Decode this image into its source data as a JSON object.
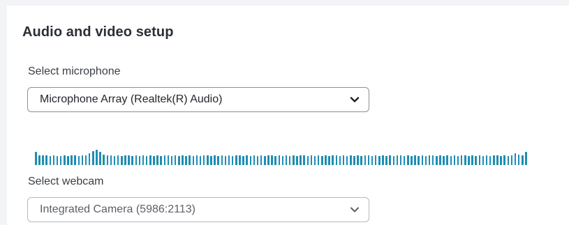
{
  "section": {
    "title": "Audio and video setup"
  },
  "microphone": {
    "label": "Select microphone",
    "selected": "Microphone Array (Realtek(R) Audio)"
  },
  "audio_level_meter": {
    "levels": [
      0.8,
      0.6,
      0.58,
      0.58,
      0.56,
      0.58,
      0.56,
      0.56,
      0.58,
      0.56,
      0.58,
      0.58,
      0.56,
      0.58,
      0.6,
      0.72,
      0.85,
      0.9,
      0.8,
      0.62,
      0.6,
      0.58,
      0.56,
      0.58,
      0.56,
      0.58,
      0.58,
      0.56,
      0.58,
      0.56,
      0.58,
      0.56,
      0.58,
      0.56,
      0.58,
      0.56,
      0.58,
      0.58,
      0.56,
      0.58,
      0.56,
      0.58,
      0.56,
      0.58,
      0.56,
      0.58,
      0.56,
      0.58,
      0.58,
      0.56,
      0.58,
      0.56,
      0.58,
      0.56,
      0.58,
      0.56,
      0.58,
      0.58,
      0.56,
      0.58,
      0.56,
      0.58,
      0.56,
      0.58,
      0.56,
      0.58,
      0.58,
      0.56,
      0.58,
      0.56,
      0.58,
      0.56,
      0.58,
      0.56,
      0.58,
      0.58,
      0.56,
      0.58,
      0.56,
      0.58,
      0.56,
      0.58,
      0.56,
      0.58,
      0.58,
      0.56,
      0.58,
      0.56,
      0.58,
      0.56,
      0.58,
      0.56,
      0.58,
      0.58,
      0.56,
      0.58,
      0.56,
      0.58,
      0.56,
      0.58,
      0.56,
      0.58,
      0.58,
      0.56,
      0.58,
      0.56,
      0.58,
      0.56,
      0.58,
      0.56,
      0.58,
      0.58,
      0.56,
      0.58,
      0.56,
      0.58,
      0.56,
      0.58,
      0.56,
      0.58,
      0.58,
      0.56,
      0.58,
      0.56,
      0.58,
      0.56,
      0.58,
      0.56,
      0.58,
      0.58,
      0.56,
      0.58,
      0.56,
      0.6,
      0.72,
      0.62,
      0.6,
      0.8
    ],
    "color": "#1f8db2"
  },
  "webcam": {
    "label": "Select webcam",
    "selected": "Integrated Camera (5986:2113)"
  },
  "icons": {
    "dropdown": "chevron-down-icon"
  }
}
